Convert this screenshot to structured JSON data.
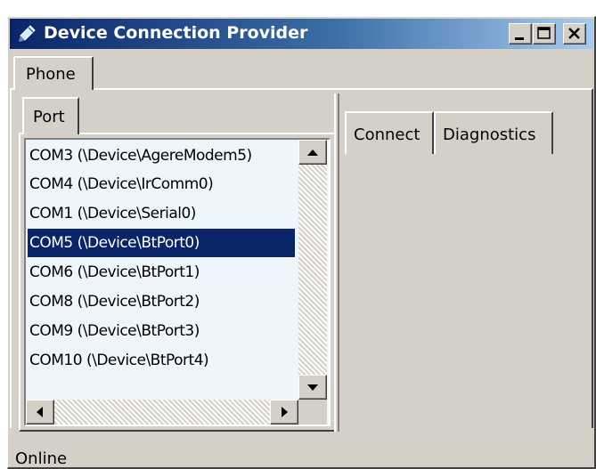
{
  "window": {
    "title": "Device Connection Provider",
    "icon": "pen-icon",
    "controls": [
      "minimize-icon",
      "maximize-icon",
      "close-icon"
    ]
  },
  "outer_tabs": [
    {
      "label": "Phone",
      "selected": true
    }
  ],
  "left_panel": {
    "tab_label": "Port",
    "ports": [
      {
        "label": "COM3 (\\Device\\AgereModem5)",
        "selected": false
      },
      {
        "label": "COM4 (\\Device\\IrComm0)",
        "selected": false
      },
      {
        "label": "COM1 (\\Device\\Serial0)",
        "selected": false
      },
      {
        "label": "COM5 (\\Device\\BtPort0)",
        "selected": true
      },
      {
        "label": "COM6 (\\Device\\BtPort1)",
        "selected": false
      },
      {
        "label": "COM8 (\\Device\\BtPort2)",
        "selected": false
      },
      {
        "label": "COM9 (\\Device\\BtPort3)",
        "selected": false
      },
      {
        "label": "COM10 (\\Device\\BtPort4)",
        "selected": false
      }
    ]
  },
  "right_panel": {
    "tabs": [
      {
        "label": "Connect"
      },
      {
        "label": "Diagnostics"
      }
    ]
  },
  "status_bar": {
    "text": "Online"
  },
  "colors": {
    "selection": "#0a246a",
    "list_background": "#eef6fc",
    "face": "#d4d0c8"
  }
}
